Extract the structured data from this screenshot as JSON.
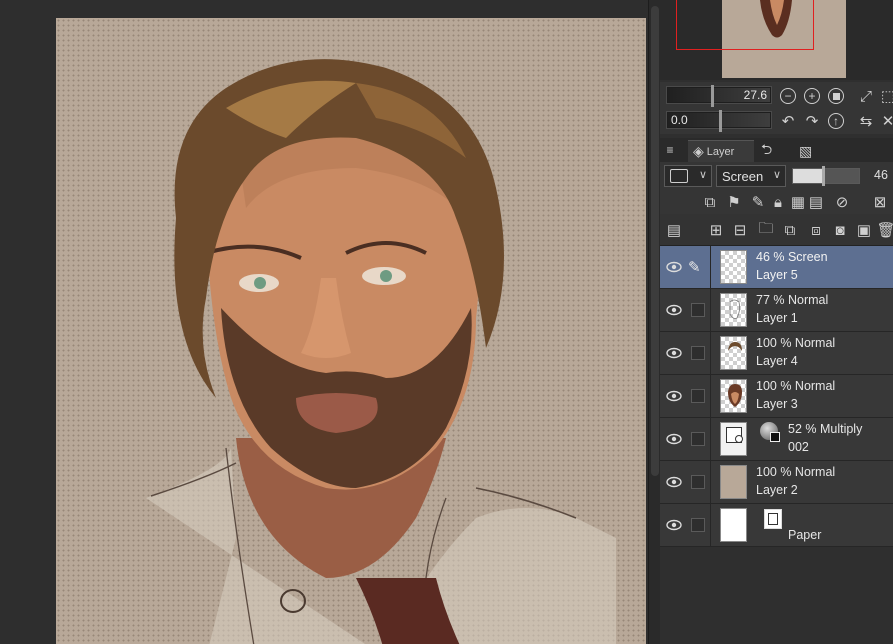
{
  "navigator": {
    "zoom_value": "27.6",
    "rotate_value": "0.0"
  },
  "tabs": [
    {
      "label": "Layer",
      "icon": "layers-icon"
    },
    {
      "label": "",
      "icon": "history-icon"
    },
    {
      "label": "",
      "icon": "material-icon"
    }
  ],
  "layer_palette": {
    "blend_mode": "Screen",
    "opacity": "46"
  },
  "layers": [
    {
      "line1": "46 % Screen",
      "line2": "Layer 5",
      "selected": true,
      "thumb": "transparent"
    },
    {
      "line1": "77 % Normal",
      "line2": "Layer 1",
      "selected": false,
      "thumb": "sketch"
    },
    {
      "line1": "100 % Normal",
      "line2": "Layer 4",
      "selected": false,
      "thumb": "hair"
    },
    {
      "line1": "100 % Normal",
      "line2": "Layer 3",
      "selected": false,
      "thumb": "face"
    },
    {
      "line1": "52 % Multiply",
      "line2": "002",
      "selected": false,
      "thumb": "folder"
    },
    {
      "line1": "100 % Normal",
      "line2": "Layer 2",
      "selected": false,
      "thumb": "tan"
    },
    {
      "line1": "",
      "line2": "Paper",
      "selected": false,
      "thumb": "white"
    }
  ],
  "colors": {
    "selected_row": "#5d6f91",
    "canvas_paper": "#b8a898",
    "nav_frame": "#e02020"
  }
}
